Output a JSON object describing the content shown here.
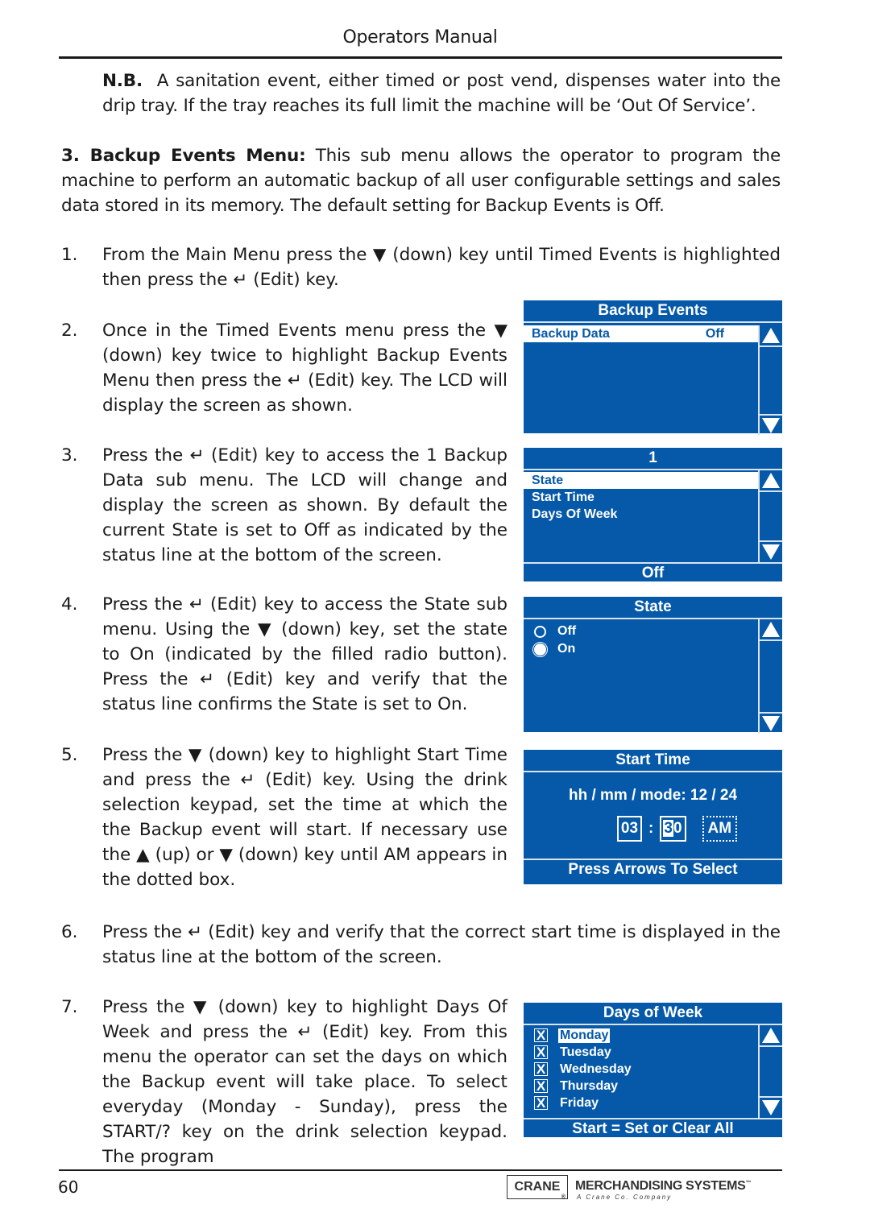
{
  "header": {
    "title": "Operators Manual"
  },
  "note": {
    "label": "N.B.",
    "text": "A sanitation event, either timed or post vend, dispenses water into the drip tray. If the tray reaches its full limit the machine will be ‘Out Of Service’."
  },
  "section": {
    "label": "3.   Backup Events Menu:",
    "text": "This sub menu allows the operator to program the machine to perform an automatic backup of all user configurable settings and sales data stored in its memory. The default setting for Backup Events is Off."
  },
  "steps": [
    {
      "num": "1.",
      "text": "From the Main Menu press the ▼ (down) key until Timed Events is highlighted then press the ↵ (Edit) key."
    },
    {
      "num": "2.",
      "text": "Once in the Timed Events menu press the ▼ (down) key twice to highlight Backup Events Menu then press the ↵ (Edit) key. The LCD will display the screen as shown."
    },
    {
      "num": "3.",
      "text": "Press the ↵ (Edit) key to access the 1 Backup Data sub menu. The LCD will change and display the screen as shown. By default the current State is set to Off as indicated by the status line at the bottom of the screen."
    },
    {
      "num": "4.",
      "text": "Press the ↵ (Edit) key to access the State sub menu. Using the ▼ (down) key, set the state to On (indicated by the filled radio button). Press the ↵ (Edit) key and verify that the status line confirms the State is set to On."
    },
    {
      "num": "5.",
      "text": "Press the ▼ (down) key to highlight Start Time and press the ↵ (Edit) key. Using the drink selection keypad, set the time at which the the Backup event will start. If necessary use the ▲ (up) or ▼ (down) key until AM appears in the dotted box."
    },
    {
      "num": "6.",
      "text": "Press the ↵ (Edit) key and verify that the correct start time is displayed in the status line at the bottom of the screen."
    },
    {
      "num": "7.",
      "text": "Press the ▼ (down) key to highlight Days Of Week and press the ↵ (Edit) key. From this menu the operator can set the days on which the Backup event will take place. To select everyday (Monday - Sunday), press the START/? key on the drink selection keypad. The program"
    }
  ],
  "lcd_backup_events": {
    "title": "Backup Events",
    "item_label": "Backup Data",
    "item_value": "Off",
    "scroll_up_icon": "up-arrow",
    "scroll_down_icon": "down-arrow"
  },
  "lcd_backup_1": {
    "title": "1",
    "items": [
      "State",
      "Start Time",
      "Days Of Week"
    ],
    "selected_index": 0,
    "status": "Off"
  },
  "lcd_state": {
    "title": "State",
    "options": [
      {
        "label": "Off",
        "selected": false
      },
      {
        "label": "On",
        "selected": true
      }
    ]
  },
  "lcd_start_time": {
    "title": "Start Time",
    "format_line": "hh / mm / mode: 12 / 24",
    "hours": "03",
    "separator": ":",
    "minutes_first": "3",
    "minutes_second": "0",
    "ampm": "AM",
    "status": "Press Arrows To Select"
  },
  "lcd_days_of_week": {
    "title": "Days of Week",
    "days": [
      {
        "label": "Monday",
        "checked": true,
        "mark": "X"
      },
      {
        "label": "Tuesday",
        "checked": true,
        "mark": "X"
      },
      {
        "label": "Wednesday",
        "checked": true,
        "mark": "X"
      },
      {
        "label": "Thursday",
        "checked": true,
        "mark": "X"
      },
      {
        "label": "Friday",
        "checked": true,
        "mark": "X"
      }
    ],
    "highlighted_index": 0,
    "status": "Start = Set or Clear All"
  },
  "footer": {
    "page_number": "60",
    "logo_box": "CRANE",
    "logo_reg": "®",
    "logo_text": "MERCHANDISING SYSTEMS",
    "logo_tm": "™",
    "logo_sub": "A Crane Co. Company"
  },
  "colors": {
    "lcd_blue": "#0559a8",
    "lcd_text": "#ffffff",
    "text": "#1a1a1a"
  }
}
